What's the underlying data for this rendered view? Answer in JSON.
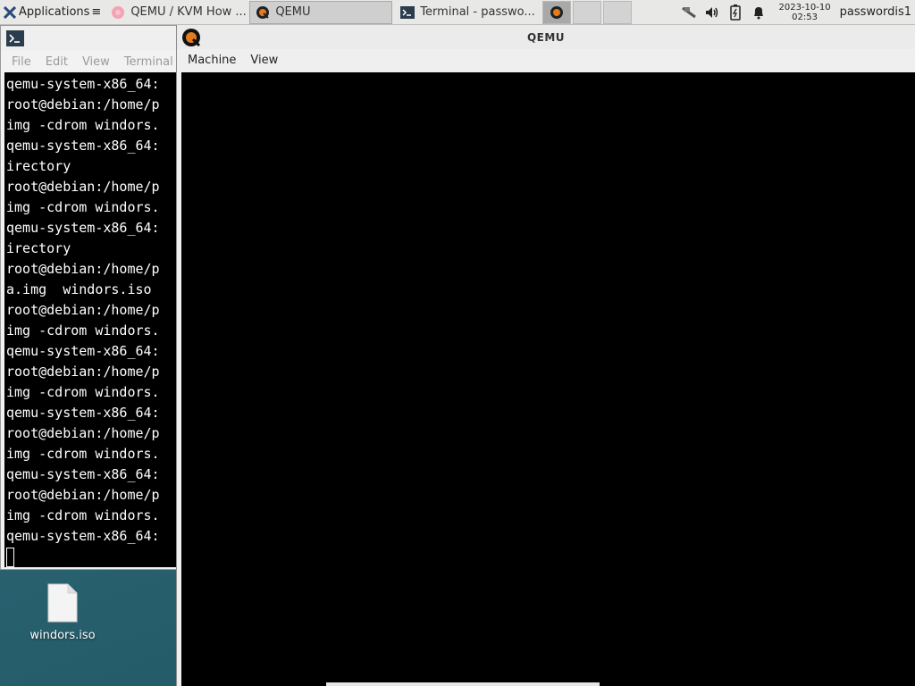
{
  "panel": {
    "apps_label": "Applications",
    "apps_suffix": "≡",
    "tasks": [
      {
        "label": "QEMU / KVM How ...",
        "icon": "firefox-icon"
      },
      {
        "label": "QEMU",
        "icon": "qemu-icon"
      },
      {
        "label": "Terminal - passwo...",
        "icon": "terminal-icon"
      }
    ],
    "clock_date": "2023-10-10",
    "clock_time": "02:53",
    "user": "passwordis1"
  },
  "terminal": {
    "menu": [
      "File",
      "Edit",
      "View",
      "Terminal"
    ],
    "lines": [
      "qemu-system-x86_64:",
      "root@debian:/home/p",
      "img -cdrom windors.",
      "qemu-system-x86_64:",
      "irectory",
      "root@debian:/home/p",
      "img -cdrom windors.",
      "qemu-system-x86_64:",
      "irectory",
      "root@debian:/home/p",
      "a.img  windors.iso",
      "root@debian:/home/p",
      "img -cdrom windors.",
      "qemu-system-x86_64:",
      "root@debian:/home/p",
      "img -cdrom windors.",
      "qemu-system-x86_64:",
      "root@debian:/home/p",
      "img -cdrom windors.",
      "qemu-system-x86_64:",
      "root@debian:/home/p",
      "img -cdrom windors.",
      "qemu-system-x86_64:"
    ]
  },
  "desktop": {
    "file_label": "windors.iso"
  },
  "qemu": {
    "title": "QEMU",
    "menu": [
      "Machine",
      "View"
    ]
  }
}
